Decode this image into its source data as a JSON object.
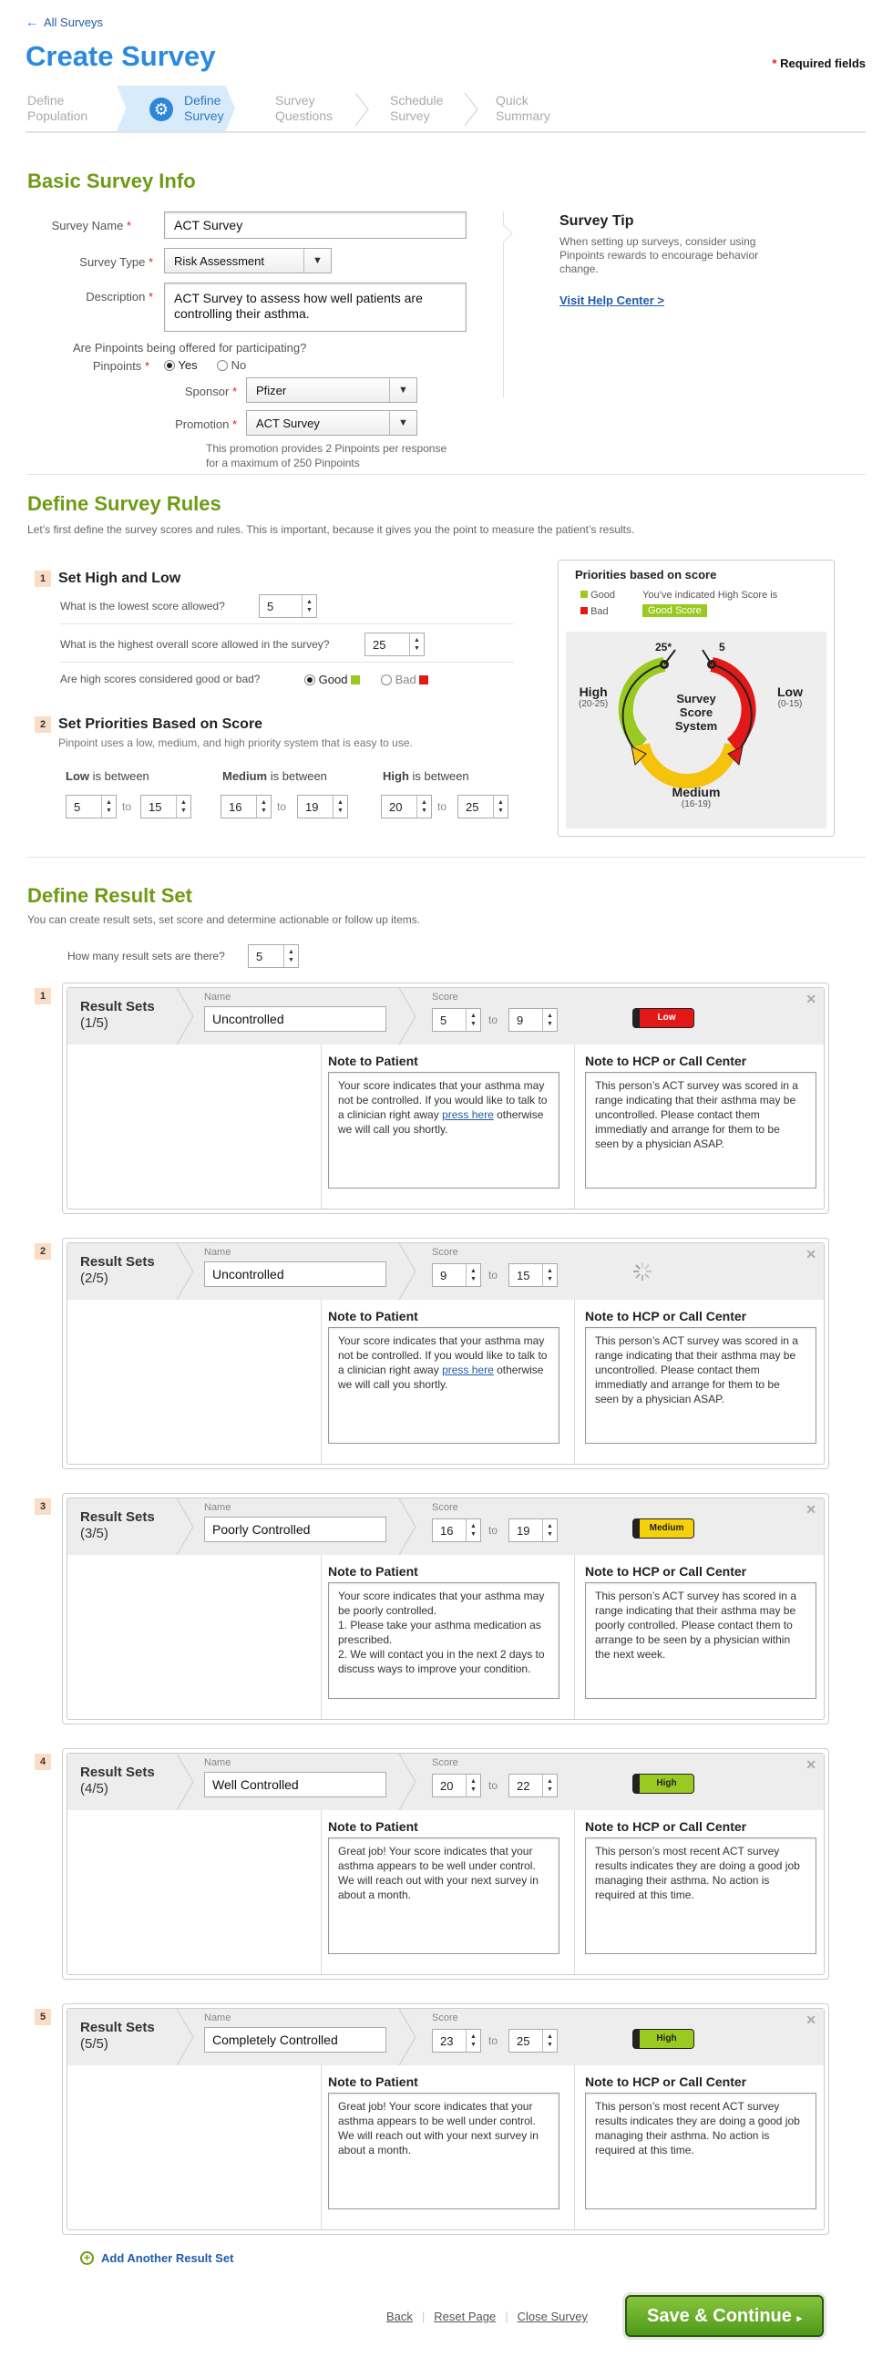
{
  "nav": {
    "back_link": "All Surveys",
    "page_title": "Create Survey",
    "required_note": "Required fields",
    "required_star": "*"
  },
  "steps": [
    {
      "label1": "Define",
      "label2": "Population"
    },
    {
      "label1": "Define",
      "label2": "Survey"
    },
    {
      "label1": "Survey",
      "label2": "Questions"
    },
    {
      "label1": "Schedule",
      "label2": "Survey"
    },
    {
      "label1": "Quick",
      "label2": "Summary"
    }
  ],
  "basic": {
    "heading": "Basic Survey Info",
    "survey_name_label": "Survey Name",
    "survey_name_value": "ACT Survey",
    "survey_type_label": "Survey Type",
    "survey_type_value": "Risk Assessment",
    "description_label": "Description",
    "description_value": "ACT Survey to assess how well patients are controlling their asthma.",
    "pinpoints_question": "Are Pinpoints being offered for participating?",
    "pinpoints_label": "Pinpoints",
    "yes": "Yes",
    "no": "No",
    "sponsor_label": "Sponsor",
    "sponsor_value": "Pfizer",
    "promotion_label": "Promotion",
    "promotion_value": "ACT Survey",
    "promo_note1": "This promotion provides 2 Pinpoints per response",
    "promo_note2": "for a maximum of 250 Pinpoints"
  },
  "tip": {
    "heading": "Survey Tip",
    "text": "When setting up surveys, consider using Pinpoints rewards to encourage behavior change.",
    "link": "Visit Help Center >"
  },
  "rules": {
    "heading": "Define Survey Rules",
    "intro": "Let’s first define the survey scores and rules.  This  is important, because it gives you the point to measure the patient’s results.",
    "step1_num": "1",
    "step1_title": "Set High and Low",
    "q_lowest": "What is the lowest score allowed?",
    "lowest_value": "5",
    "q_highest": "What is the highest overall score allowed in the survey?",
    "highest_value": "25",
    "q_goodbad": "Are high scores considered good or bad?",
    "good": "Good",
    "bad": "Bad",
    "step2_num": "2",
    "step2_title": "Set Priorities Based on Score",
    "step2_sub": "Pinpoint uses a low, medium, and high priority system that is easy to use.",
    "is_between": "is between",
    "to": "to",
    "low_label": "Low",
    "low_from": "5",
    "low_to": "15",
    "med_label": "Medium",
    "med_from": "16",
    "med_to": "19",
    "high_label": "High",
    "high_from": "20",
    "high_to": "25"
  },
  "priorities": {
    "heading": "Priorities based on score",
    "good": "Good",
    "bad": "Bad",
    "indicated": "You’ve indicated High Score is",
    "good_score": "Good Score",
    "high": "High",
    "high_range": "(20-25)",
    "low": "Low",
    "low_range": "(0-15)",
    "medium": "Medium",
    "medium_range": "(16-19)",
    "center1": "Survey",
    "center2": "Score",
    "center3": "System",
    "top_left": "25*",
    "top_right": "5",
    "colors": {
      "green": "#9ac921",
      "yellow": "#f5c20c",
      "red": "#e31818"
    }
  },
  "results": {
    "heading": "Define Result Set",
    "intro": "You can create result sets, set score and determine actionable or follow up items.",
    "how_many": "How many result sets are there?",
    "how_many_value": "5",
    "name_label": "Name",
    "score_label": "Score",
    "to": "to",
    "title": "Result Sets",
    "patient_head": "Note to Patient",
    "hcp_head": "Note to HCP or Call Center",
    "sets": [
      {
        "num": "1",
        "fraction": "(1/5)",
        "name": "Uncontrolled",
        "from": "5",
        "to": "9",
        "badge": "Low",
        "badge_type": "low",
        "patient_a": "Your score indicates that your asthma may not be controlled.  If you would like to talk to a clinician right away ",
        "patient_link": "press here",
        "patient_b": " otherwise we will call you shortly.",
        "hcp": "This person’s ACT survey was scored in a range indicating that their asthma may be uncontrolled.  Please contact them immediatly and arrange for them to be seen by a physician ASAP."
      },
      {
        "num": "2",
        "fraction": "(2/5)",
        "name": "Uncontrolled",
        "from": "9",
        "to": "15",
        "badge": "",
        "badge_type": "loading",
        "patient_a": "Your score indicates that your asthma may not be controlled.  If you would like to talk to a clinician right away ",
        "patient_link": "press here",
        "patient_b": " otherwise we will call you shortly.",
        "hcp": "This person’s ACT survey was scored in a range indicating that their asthma may be uncontrolled.  Please contact them immediatly and arrange for them to be seen by a physician ASAP."
      },
      {
        "num": "3",
        "fraction": "(3/5)",
        "name": "Poorly Controlled",
        "from": "16",
        "to": "19",
        "badge": "Medium",
        "badge_type": "med",
        "patient_a": "Your score indicates that your asthma may be poorly controlled.\n1. Please take your asthma medication as prescribed.\n2. We will contact you in the next 2 days to discuss ways to improve your condition.",
        "patient_link": "",
        "patient_b": "",
        "hcp": "This person’s ACT survey has scored in a range indicating that their asthma may be poorly controlled.  Please contact them to arrange to be seen by a physician within the next week."
      },
      {
        "num": "4",
        "fraction": "(4/5)",
        "name": "Well Controlled",
        "from": "20",
        "to": "22",
        "badge": "High",
        "badge_type": "high",
        "patient_a": "Great job!  Your score indicates that your asthma appears to be well under control.  We will reach out with your next survey in about a month.",
        "patient_link": "",
        "patient_b": "",
        "hcp": "This person’s most recent ACT survey results indicates they are doing a good job managing their asthma.  No action is required at this time."
      },
      {
        "num": "5",
        "fraction": "(5/5)",
        "name": "Completely Controlled",
        "from": "23",
        "to": "25",
        "badge": "High",
        "badge_type": "high",
        "patient_a": "Great job!  Your score indicates that your asthma appears to be well under control.  We will reach out with your next survey in about a month.",
        "patient_link": "",
        "patient_b": "",
        "hcp": "This person’s most recent ACT survey results indicates they are doing a good job managing their asthma.  No action is required at this time."
      }
    ],
    "add_another": "Add Another Result Set"
  },
  "footer": {
    "back": "Back",
    "reset": "Reset Page",
    "close": "Close Survey",
    "save": "Save & Continue"
  }
}
